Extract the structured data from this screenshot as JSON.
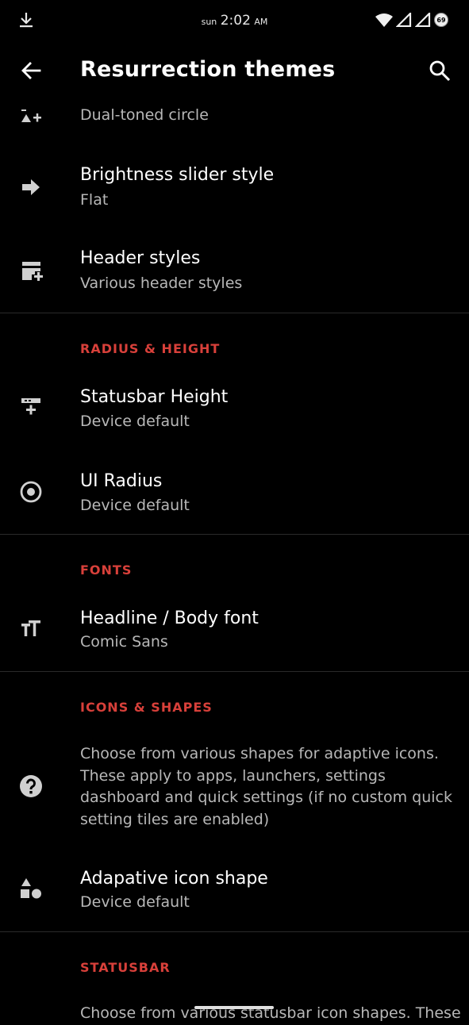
{
  "status_bar": {
    "day": "sun",
    "time": "2:02",
    "ampm": "AM",
    "battery": "69"
  },
  "app_bar": {
    "title": "Resurrection themes"
  },
  "items": {
    "partial_sub": "Dual-toned circle",
    "brightness": {
      "title": "Brightness slider style",
      "sub": "Flat"
    },
    "header": {
      "title": "Header styles",
      "sub": "Various header styles"
    },
    "statusbar_height": {
      "title": "Statusbar Height",
      "sub": "Device default"
    },
    "ui_radius": {
      "title": "UI Radius",
      "sub": "Device default"
    },
    "font": {
      "title": "Headline / Body font",
      "sub": "Comic Sans"
    },
    "icon_shape": {
      "title": "Adapative icon shape",
      "sub": "Device default"
    }
  },
  "sections": {
    "radius": "RADIUS & HEIGHT",
    "fonts": "FONTS",
    "icons": "ICONS & SHAPES",
    "statusbar": "STATUSBAR"
  },
  "descriptions": {
    "icons": "Choose from various shapes for adaptive icons. These apply to apps, launchers, settings dashboard and quick settings (if no custom quick setting tiles are enabled)",
    "statusbar": "Choose from various statusbar icon shapes. These"
  },
  "colors": {
    "accent": "#d8403a",
    "background": "#000000",
    "secondary_text": "#b8b8b8"
  }
}
